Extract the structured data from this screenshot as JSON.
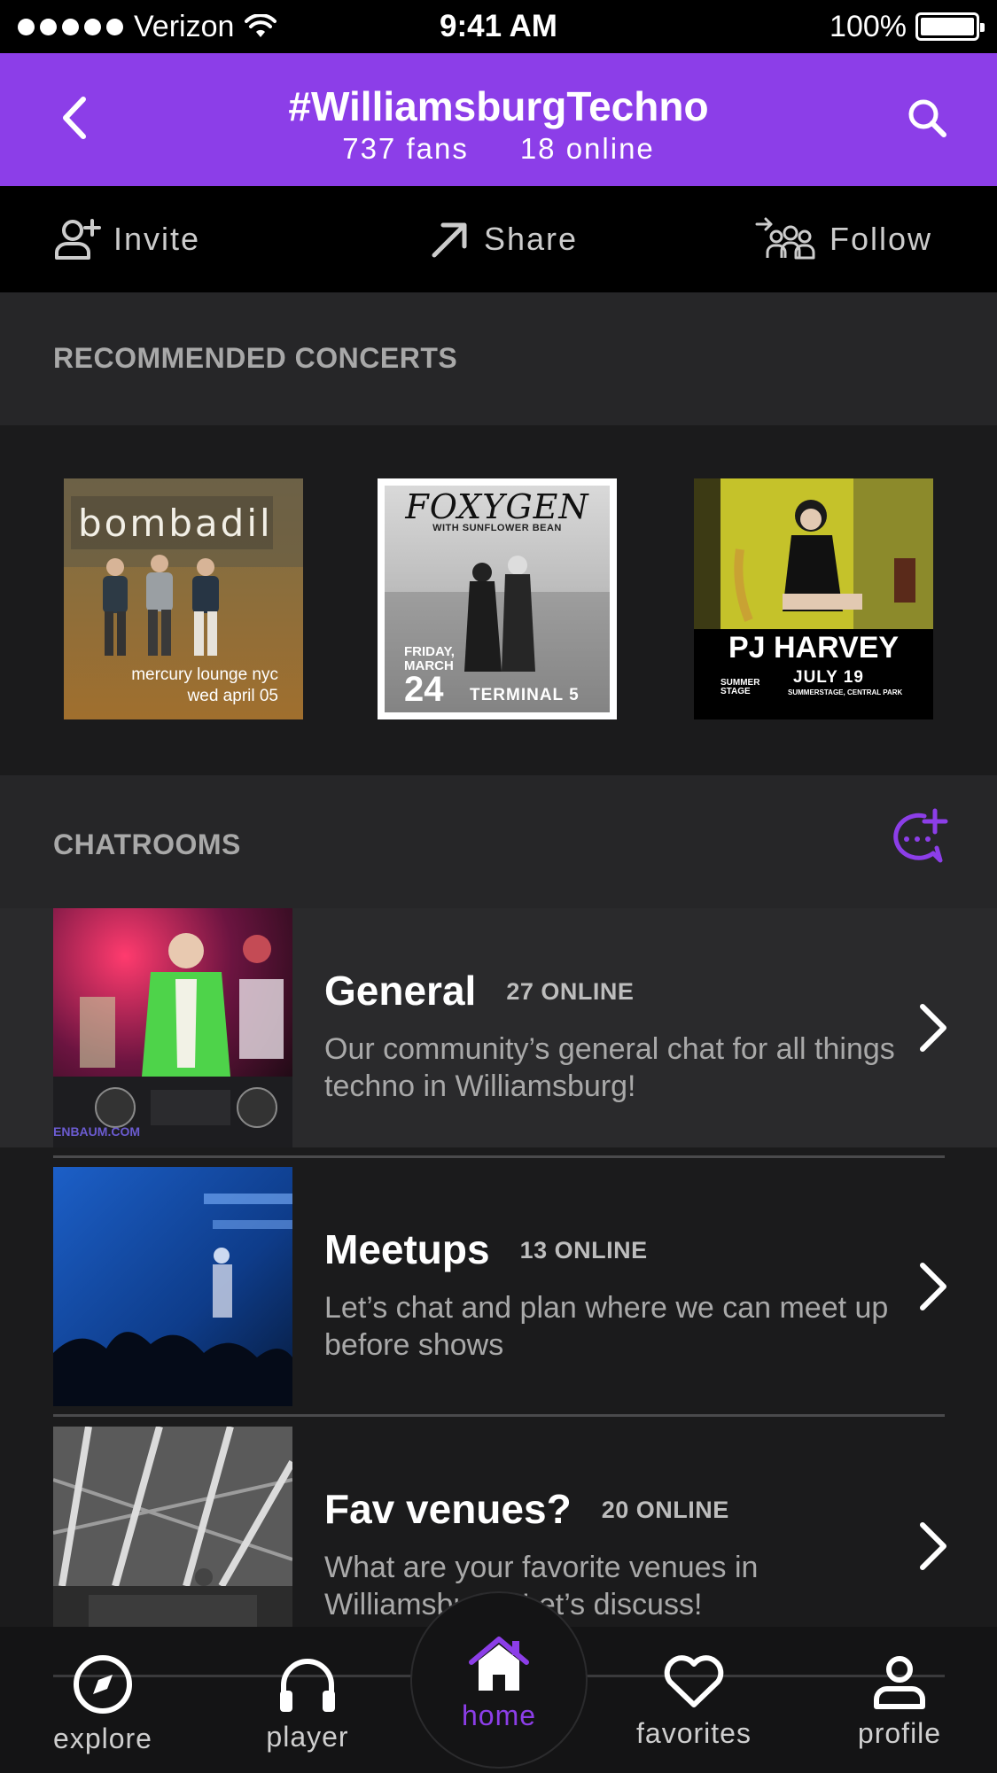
{
  "status_bar": {
    "carrier": "Verizon",
    "time": "9:41 AM",
    "battery": "100%"
  },
  "header": {
    "title": "#WilliamsburgTechno",
    "fans": "737 fans",
    "online": "18 online"
  },
  "actions": {
    "invite": "Invite",
    "share": "Share",
    "follow": "Follow"
  },
  "sections": {
    "concerts": "RECOMMENDED CONCERTS",
    "chatrooms": "CHATROOMS"
  },
  "concerts": [
    {
      "artist": "bombadil",
      "venue": "mercury lounge nyc",
      "date": "wed april 05"
    },
    {
      "artist": "FOXYGEN",
      "support": "WITH SUNFLOWER BEAN",
      "day": "FRIDAY,",
      "month": "MARCH",
      "date_num": "24",
      "venue": "TERMINAL 5"
    },
    {
      "artist": "PJ HARVEY",
      "date": "JULY 19",
      "venue": "SUMMERSTAGE, CENTRAL PARK",
      "sponsor": "SUMMER STAGE"
    }
  ],
  "chatrooms": [
    {
      "name": "General",
      "online": "27 ONLINE",
      "description": "Our community’s general chat for all things techno in Williamsburg!",
      "watermark": "ENBAUM.COM"
    },
    {
      "name": "Meetups",
      "online": "13 ONLINE",
      "description": "Let’s chat and plan where we can meet up before shows"
    },
    {
      "name": "Fav venues?",
      "online": "20 ONLINE",
      "description": "What are your favorite venues in Williamsburg? Let’s discuss!"
    }
  ],
  "tabs": {
    "explore": "explore",
    "player": "player",
    "home": "home",
    "favorites": "favorites",
    "profile": "profile"
  },
  "colors": {
    "accent": "#8c3ee8",
    "background": "#1b1b1c",
    "section": "#262628"
  }
}
